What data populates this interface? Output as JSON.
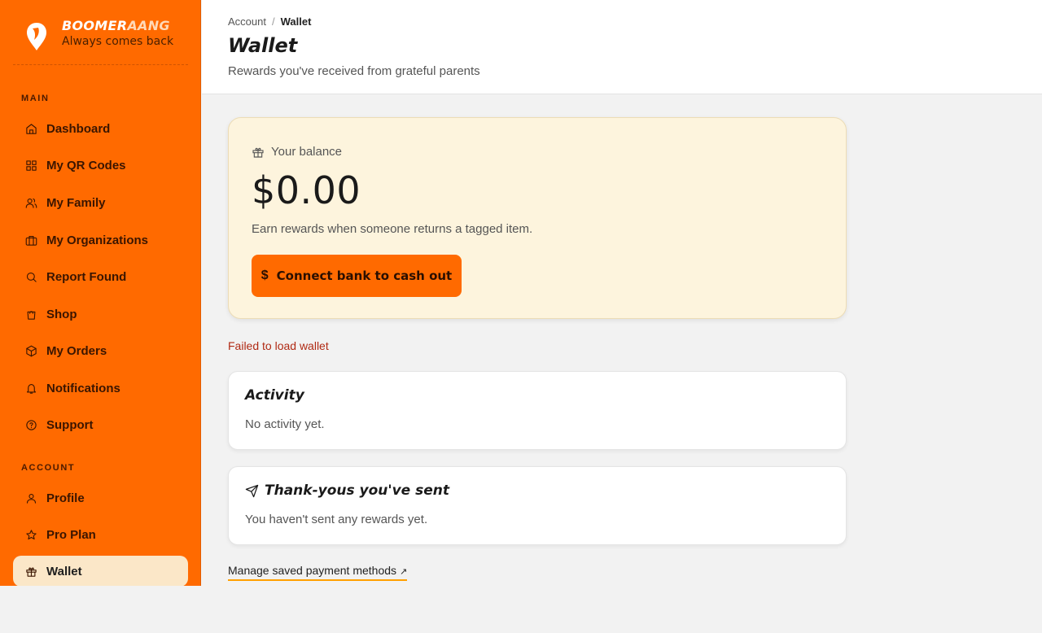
{
  "brand": {
    "name_main": "BOOMER",
    "name_accent": "AANG",
    "tagline": "Always comes back"
  },
  "sidebar": {
    "main_label": "MAIN",
    "account_label": "ACCOUNT",
    "main_items": [
      {
        "label": "Dashboard",
        "icon": "home-icon"
      },
      {
        "label": "My QR Codes",
        "icon": "grid-icon"
      },
      {
        "label": "My Family",
        "icon": "users-icon"
      },
      {
        "label": "My Organizations",
        "icon": "briefcase-icon"
      },
      {
        "label": "Report Found",
        "icon": "search-icon"
      },
      {
        "label": "Shop",
        "icon": "shopping-bag-icon"
      },
      {
        "label": "My Orders",
        "icon": "package-icon"
      },
      {
        "label": "Notifications",
        "icon": "bell-icon"
      },
      {
        "label": "Support",
        "icon": "help-circle-icon"
      }
    ],
    "account_items": [
      {
        "label": "Profile",
        "icon": "user-icon"
      },
      {
        "label": "Pro Plan",
        "icon": "star-icon"
      },
      {
        "label": "Wallet",
        "icon": "gift-icon",
        "active": true
      }
    ]
  },
  "header": {
    "breadcrumb": [
      "Account",
      "Wallet"
    ],
    "separator": "/",
    "title": "Wallet",
    "subtitle": "Rewards you've received from grateful parents"
  },
  "balance": {
    "label": "Your balance",
    "amount": "$0.00",
    "note": "Earn rewards when someone returns a tagged item.",
    "button_icon": "$",
    "button_label": "Connect bank to cash out"
  },
  "error": "Failed to load wallet",
  "activity": {
    "title": "Activity",
    "empty": "No activity yet."
  },
  "thanks": {
    "title": "Thank-yous you've sent",
    "empty": "You haven't sent any rewards yet."
  },
  "manage_link": {
    "label": "Manage saved payment methods",
    "arrow": "↗"
  },
  "colors": {
    "brand": "#ff6a00",
    "active_nav": "#fbe7c8",
    "balance_bg": "#fdf4dd",
    "error": "#b02a14",
    "link_underline": "#ffa000"
  }
}
